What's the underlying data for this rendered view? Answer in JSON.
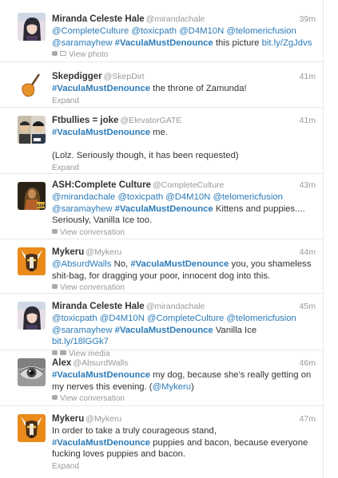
{
  "tweets": [
    {
      "name": "Miranda Celeste Hale",
      "handle": "@mirandachale",
      "time": "39m",
      "lines": [
        [
          {
            "t": "@CompleteCulture",
            "c": "lk"
          },
          {
            "t": " "
          },
          {
            "t": "@toxicpath",
            "c": "lk"
          },
          {
            "t": " "
          },
          {
            "t": "@D4M10N",
            "c": "lk"
          },
          {
            "t": " "
          },
          {
            "t": "@telomericfusion",
            "c": "lk"
          }
        ],
        [
          {
            "t": "@saramayhew",
            "c": "lk"
          },
          {
            "t": " "
          },
          {
            "t": "#VaculaMustDenounce",
            "c": "tag"
          },
          {
            "t": " this picture "
          },
          {
            "t": "bit.ly/ZgJdvs",
            "c": "lk"
          }
        ]
      ],
      "action": "View photo",
      "action_icon": "photo"
    },
    {
      "name": "Skepdigger",
      "handle": "@SkepDirt",
      "time": "41m",
      "lines": [
        [
          {
            "t": "#VaculaMustDenounce",
            "c": "tag"
          },
          {
            "t": " the throne of Zamunda!"
          }
        ]
      ],
      "action": "Expand",
      "action_icon": ""
    },
    {
      "name": "Ftbullies = joke",
      "handle": "@ElevatorGATE",
      "time": "41m",
      "lines": [
        [
          {
            "t": "#VaculaMustDenounce",
            "c": "tag"
          },
          {
            "t": " me."
          }
        ],
        [
          {
            "t": " "
          }
        ],
        [
          {
            "t": "(Lolz. Seriously though, it has been requested)"
          }
        ]
      ],
      "action": "Expand",
      "action_icon": ""
    },
    {
      "name": "ASH:Complete Culture",
      "handle": "@CompleteCulture",
      "time": "43m",
      "lines": [
        [
          {
            "t": "@mirandachale",
            "c": "lk"
          },
          {
            "t": " "
          },
          {
            "t": "@toxicpath",
            "c": "lk"
          },
          {
            "t": " "
          },
          {
            "t": "@D4M10N",
            "c": "lk"
          },
          {
            "t": " "
          },
          {
            "t": "@telomericfusion",
            "c": "lk"
          }
        ],
        [
          {
            "t": "@saramayhew",
            "c": "lk"
          },
          {
            "t": " "
          },
          {
            "t": "#VaculaMustDenounce",
            "c": "tag"
          },
          {
            "t": " Kittens and puppies...."
          }
        ],
        [
          {
            "t": "Seriously, Vanilla Ice too."
          }
        ]
      ],
      "action": "View conversation",
      "action_icon": "bubble"
    },
    {
      "name": "Mykeru",
      "handle": "@Mykeru",
      "time": "44m",
      "lines": [
        [
          {
            "t": "@AbsurdWalls",
            "c": "lk"
          },
          {
            "t": " No, "
          },
          {
            "t": "#VaculaMustDenounce",
            "c": "tag"
          },
          {
            "t": " you, you shameless"
          }
        ],
        [
          {
            "t": "shit-bag, for dragging your poor, innocent dog into this."
          }
        ]
      ],
      "action": "View conversation",
      "action_icon": "bubble"
    },
    {
      "name": "Miranda Celeste Hale",
      "handle": "@mirandachale",
      "time": "45m",
      "lines": [
        [
          {
            "t": "@toxicpath",
            "c": "lk"
          },
          {
            "t": " "
          },
          {
            "t": "@D4M10N",
            "c": "lk"
          },
          {
            "t": " "
          },
          {
            "t": "@CompleteCulture",
            "c": "lk"
          },
          {
            "t": " "
          },
          {
            "t": "@telomericfusion",
            "c": "lk"
          }
        ],
        [
          {
            "t": "@saramayhew",
            "c": "lk"
          },
          {
            "t": " "
          },
          {
            "t": "#VaculaMustDenounce",
            "c": "tag"
          },
          {
            "t": " Vanilla Ice "
          },
          {
            "t": "bit.ly/18lGGk7",
            "c": "lk"
          }
        ]
      ],
      "action": "View media",
      "action_icon": "media"
    },
    {
      "name": "Alex",
      "handle": "@AbsurdWalls",
      "time": "46m",
      "lines": [
        [
          {
            "t": "#VaculaMustDenounce",
            "c": "tag"
          },
          {
            "t": " my dog, because she's really getting on"
          }
        ],
        [
          {
            "t": "my nerves this evening. ("
          },
          {
            "t": "@Mykeru",
            "c": "lk"
          },
          {
            "t": ")"
          }
        ]
      ],
      "action": "View conversation",
      "action_icon": "bubble"
    },
    {
      "name": "Mykeru",
      "handle": "@Mykeru",
      "time": "47m",
      "lines": [
        [
          {
            "t": "In order to take a truly courageous stand,"
          }
        ],
        [
          {
            "t": "#VaculaMustDenounce",
            "c": "tag"
          },
          {
            "t": " puppies and bacon, because everyone"
          }
        ],
        [
          {
            "t": "fucking loves puppies and bacon."
          }
        ]
      ],
      "action": "Expand",
      "action_icon": ""
    }
  ]
}
